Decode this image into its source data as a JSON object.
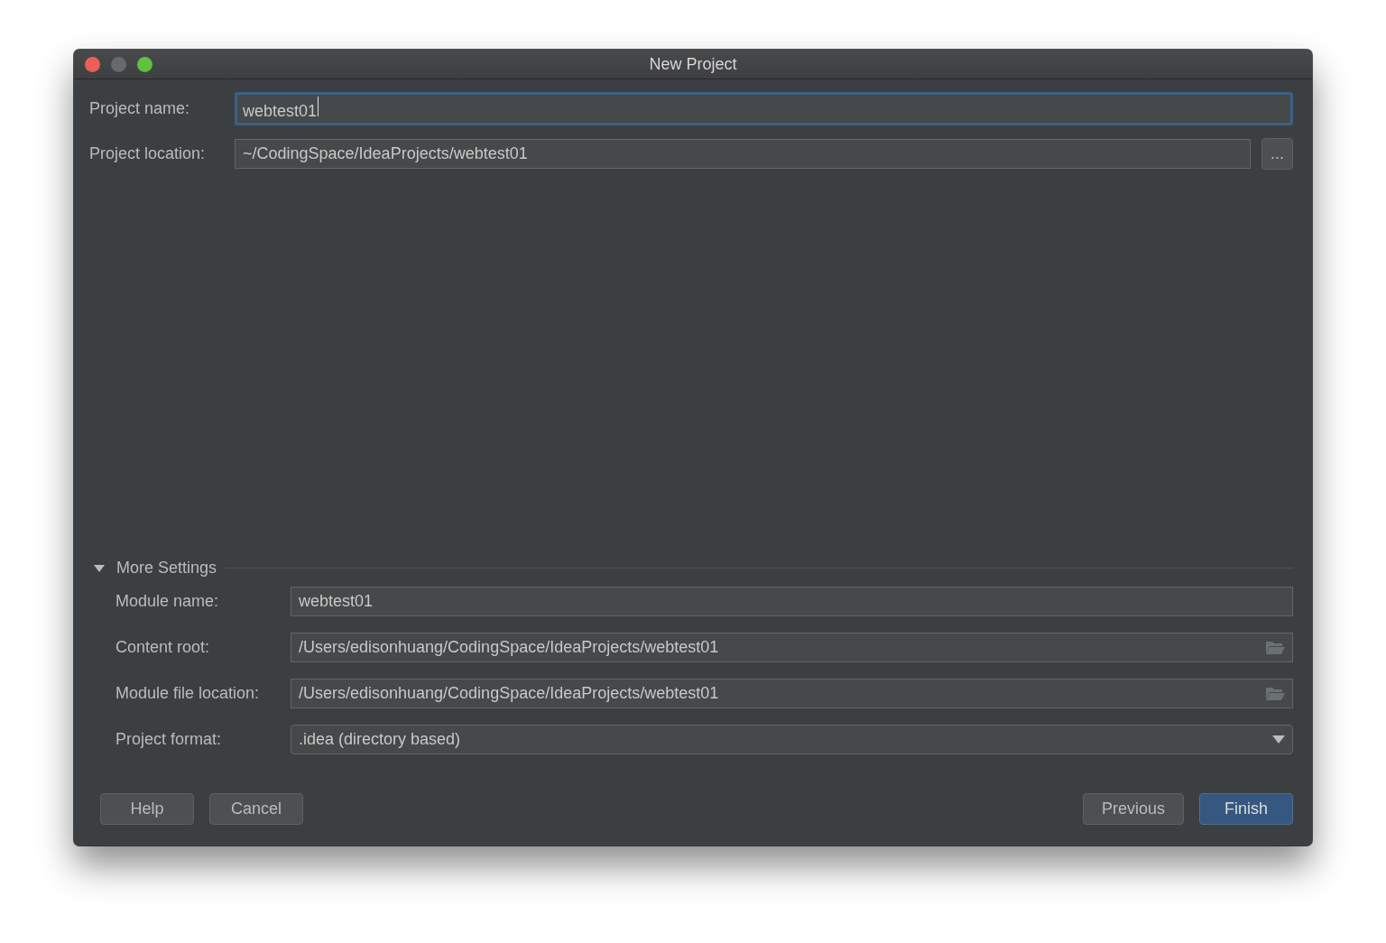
{
  "window": {
    "title": "New Project"
  },
  "fields": [
    {
      "label": "Project name:",
      "value": "webtest01",
      "focused": true
    },
    {
      "label": "Project location:",
      "value": "~/CodingSpace/IdeaProjects/webtest01",
      "focused": false,
      "browse_button": "..."
    }
  ],
  "more_settings": {
    "label": "More Settings",
    "expanded": true,
    "fields": [
      {
        "kind": "text",
        "label": "Module name:",
        "value": "webtest01"
      },
      {
        "kind": "folder",
        "label": "Content root:",
        "value": "/Users/edisonhuang/CodingSpace/IdeaProjects/webtest01"
      },
      {
        "kind": "folder",
        "label": "Module file location:",
        "value": "/Users/edisonhuang/CodingSpace/IdeaProjects/webtest01"
      },
      {
        "kind": "dropdown",
        "label": "Project format:",
        "value": ".idea (directory based)"
      }
    ]
  },
  "buttons_left": [
    {
      "label": "Help",
      "default": false
    },
    {
      "label": "Cancel",
      "default": false
    }
  ],
  "buttons_right": [
    {
      "label": "Previous",
      "default": false
    },
    {
      "label": "Finish",
      "default": true
    }
  ]
}
